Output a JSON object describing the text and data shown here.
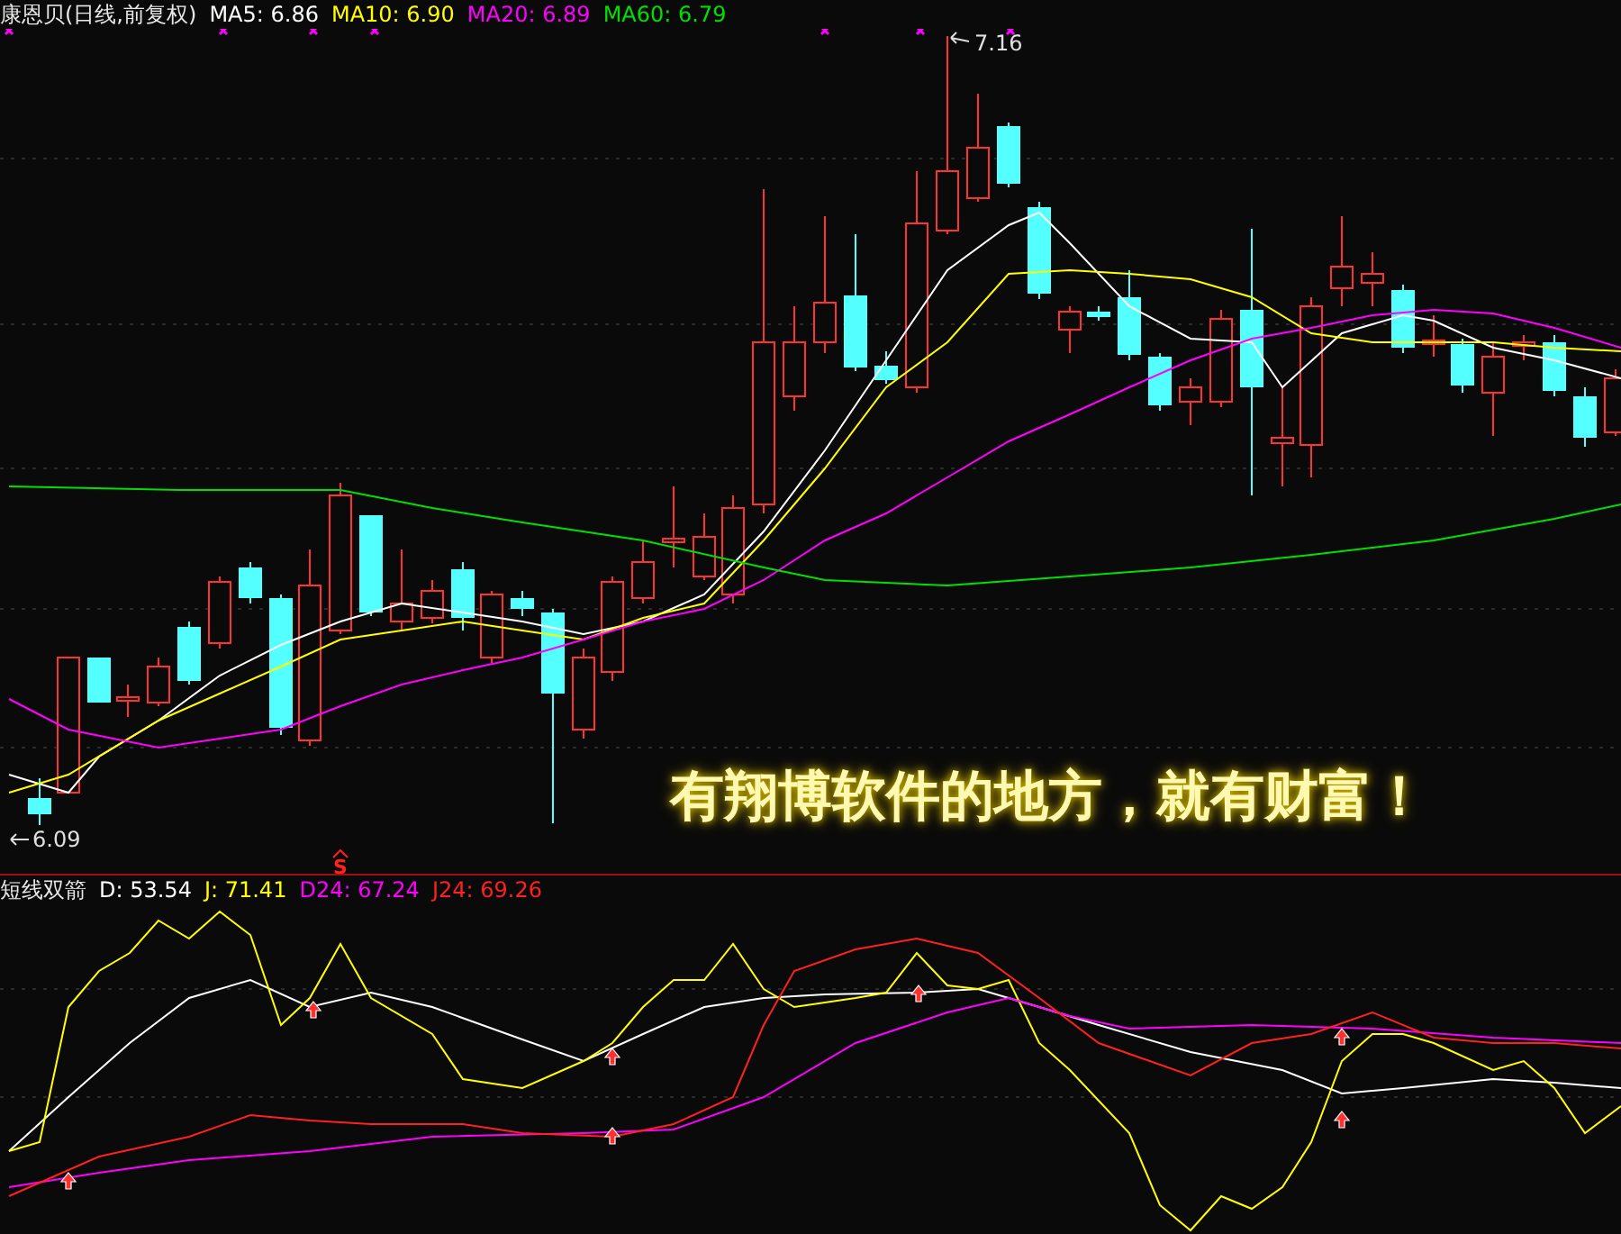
{
  "header": {
    "title": "康恩贝(日线,前复权)",
    "indicators": [
      {
        "label": "MA5: 6.86",
        "color": "#ffffff"
      },
      {
        "label": "MA10: 6.90",
        "color": "#ffff00"
      },
      {
        "label": "MA20: 6.89",
        "color": "#ff00ff"
      },
      {
        "label": "MA60: 6.79",
        "color": "#00e000"
      }
    ]
  },
  "main_chart": {
    "high_label": "7.16",
    "low_label": "6.09",
    "signal": "S",
    "slogan": "有翔博软件的地方，就有财富！"
  },
  "indicator_panel": {
    "title": "短线双箭",
    "indicators": [
      {
        "label": "D: 53.54",
        "color": "#ffffff"
      },
      {
        "label": "J: 71.41",
        "color": "#ffff00"
      },
      {
        "label": "D24: 67.24",
        "color": "#ff00ff"
      },
      {
        "label": "J24: 69.26",
        "color": "#ff2020"
      }
    ]
  }
}
